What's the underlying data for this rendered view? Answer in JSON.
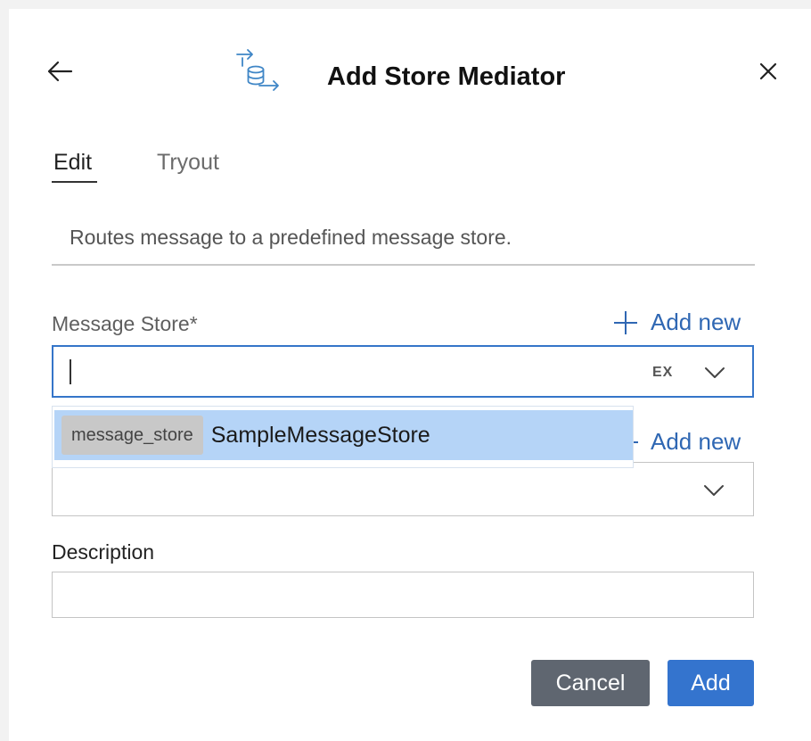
{
  "header": {
    "title": "Add Store Mediator",
    "icon": "store-mediator-icon",
    "back_icon": "arrow-left-icon",
    "close_icon": "close-icon"
  },
  "tabs": [
    {
      "label": "Edit",
      "active": true
    },
    {
      "label": "Tryout",
      "active": false
    }
  ],
  "description_text": "Routes message to a predefined message store.",
  "form": {
    "message_store": {
      "label": "Message Store*",
      "value": "",
      "expression_badge": "EX",
      "add_new_label": "Add new"
    },
    "second_field": {
      "add_new_label": "Add new",
      "value": ""
    },
    "description": {
      "label": "Description",
      "value": ""
    }
  },
  "dropdown": {
    "options": [
      {
        "tag": "message_store",
        "name": "SampleMessageStore",
        "highlighted": true
      }
    ]
  },
  "actions": {
    "cancel_label": "Cancel",
    "add_label": "Add"
  },
  "colors": {
    "accent": "#3474ce",
    "link": "#2f67b3",
    "highlight": "#b5d4f7",
    "cancel": "#5f6670"
  }
}
